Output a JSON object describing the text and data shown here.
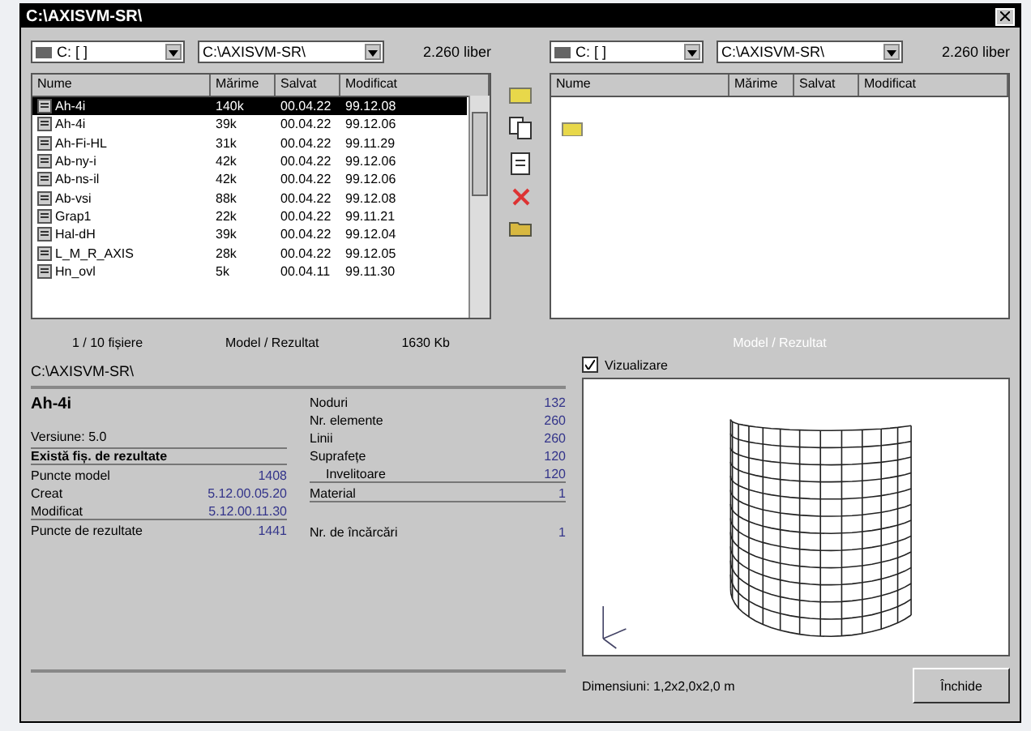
{
  "window": {
    "title": "C:\\AXISVM-SR\\"
  },
  "left_browser": {
    "drive": "C: [ ]",
    "path": "C:\\AXISVM-SR\\",
    "free": "2.260 liber",
    "columns": [
      "Nume",
      "Mărime",
      "Salvat",
      "Modificat"
    ],
    "rows": [
      {
        "name": "Ah-4i",
        "size": "140k",
        "saved": "00.04.22",
        "modified": "99.12.08",
        "selected": true
      },
      {
        "name": "Ah-4i",
        "size": "39k",
        "saved": "00.04.22",
        "modified": "99.12.06",
        "selected": false
      },
      {
        "name": "Ah-Fi-HL",
        "size": "31k",
        "saved": "00.04.22",
        "modified": "99.11.29",
        "selected": false
      },
      {
        "name": "Ab-ny-i",
        "size": "42k",
        "saved": "00.04.22",
        "modified": "99.12.06",
        "selected": false
      },
      {
        "name": "Ab-ns-il",
        "size": "42k",
        "saved": "00.04.22",
        "modified": "99.12.06",
        "selected": false
      },
      {
        "name": "Ab-vsi",
        "size": "88k",
        "saved": "00.04.22",
        "modified": "99.12.08",
        "selected": false
      },
      {
        "name": "Grap1",
        "size": "22k",
        "saved": "00.04.22",
        "modified": "99.11.21",
        "selected": false
      },
      {
        "name": "Hal-dH",
        "size": "39k",
        "saved": "00.04.22",
        "modified": "99.12.04",
        "selected": false
      },
      {
        "name": "L_M_R_AXIS",
        "size": "28k",
        "saved": "00.04.22",
        "modified": "99.12.05",
        "selected": false
      },
      {
        "name": "Hn_ovl",
        "size": "5k",
        "saved": "00.04.11",
        "modified": "99.11.30",
        "selected": false
      }
    ],
    "status": [
      "1 / 10 fișiere",
      "Model / Rezultat",
      "1630 Kb"
    ]
  },
  "right_browser": {
    "drive": "C: [ ]",
    "path": "C:\\AXISVM-SR\\",
    "free": "2.260 liber",
    "columns": [
      "Nume",
      "Mărime",
      "Salvat",
      "Modificat"
    ],
    "status": "Model / Rezultat"
  },
  "info": {
    "path": "C:\\AXISVM-SR\\",
    "model": "Ah-4i",
    "version": "Versiune: 5.0",
    "results_note": "Există fiș. de rezultate",
    "left_rows": [
      {
        "label": "Puncte model",
        "value": "1408"
      },
      {
        "label": "Creat",
        "value": "5.12.00.05.20"
      },
      {
        "label": "Modificat",
        "value": "5.12.00.11.30"
      },
      {
        "label": "Puncte de rezultate",
        "value": "1441"
      }
    ],
    "right_rows": [
      {
        "label": "Noduri",
        "value": "132"
      },
      {
        "label": "Nr. elemente",
        "value": "260"
      },
      {
        "label": "Linii",
        "value": "260"
      },
      {
        "label": "Suprafețe",
        "value": "120"
      },
      {
        "label": "Invelitoare",
        "value": "120"
      },
      {
        "label": "Material",
        "value": "1"
      },
      {
        "label": "Nr. de încărcări",
        "value": "1"
      }
    ]
  },
  "preview": {
    "label": "Vizualizare",
    "checked": true,
    "dimensions": "Dimensiuni: 1,2x2,0x2,0 m",
    "close_button": "Închide"
  }
}
